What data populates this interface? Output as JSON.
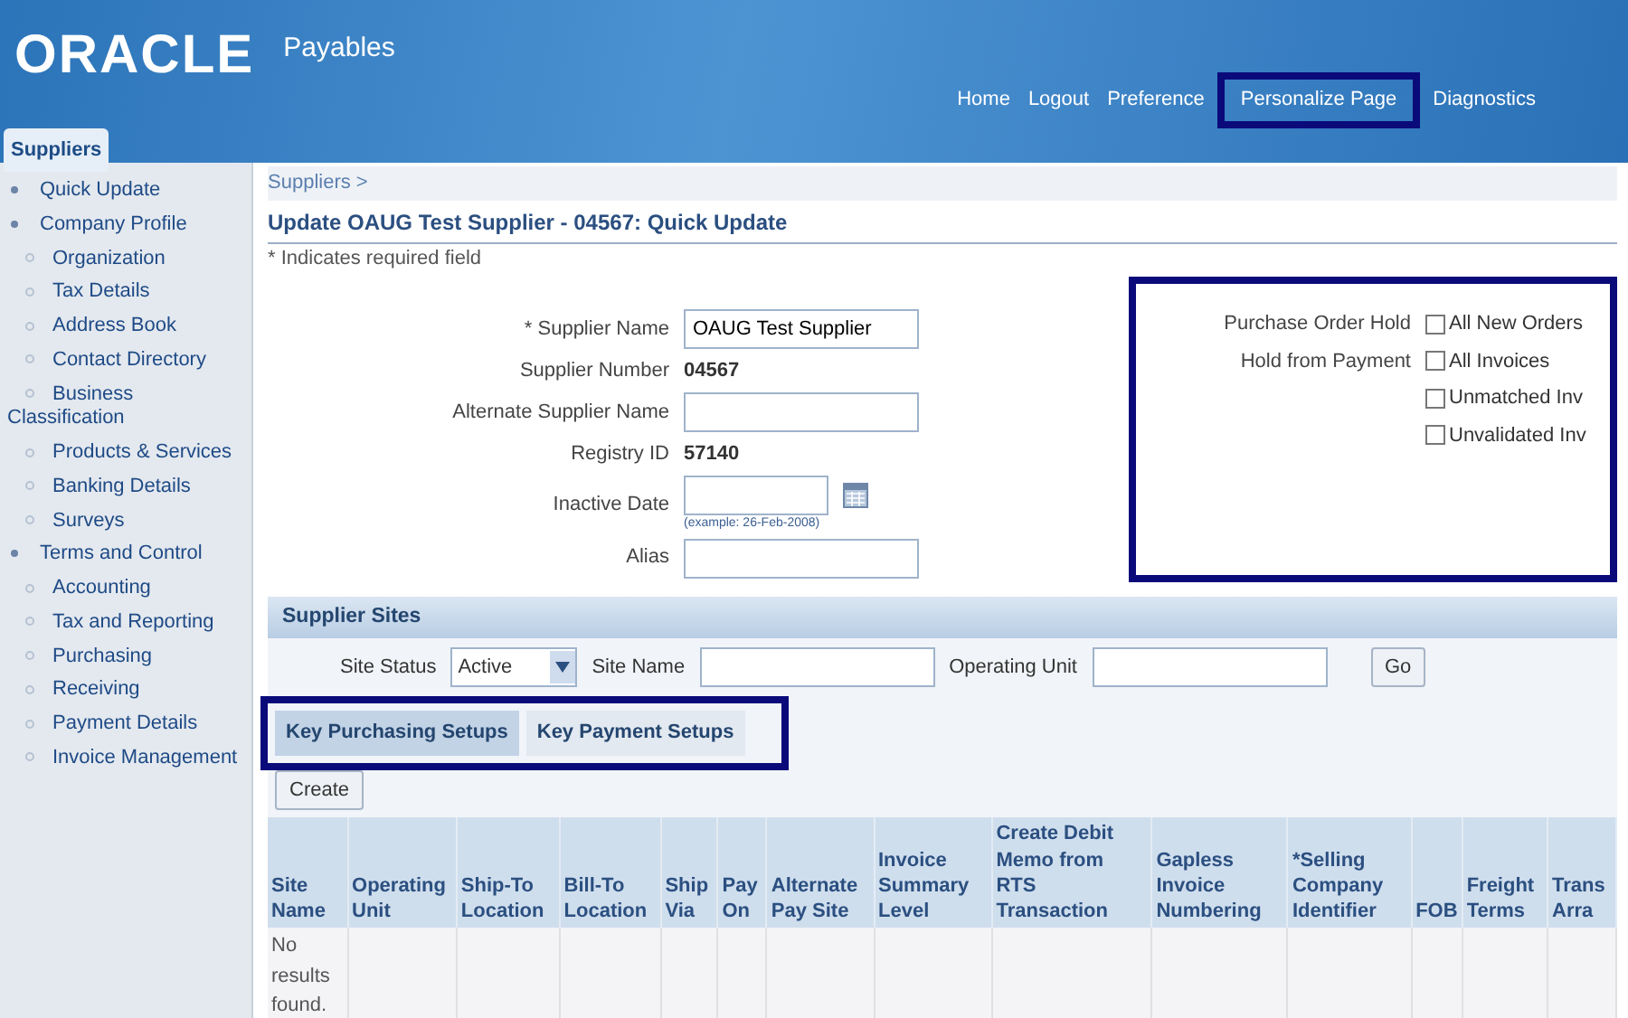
{
  "header": {
    "logo": "ORACLE",
    "app": "Payables",
    "links": [
      {
        "label": "Home",
        "highlighted": false
      },
      {
        "label": "Logout",
        "highlighted": false
      },
      {
        "label": "Preference",
        "highlighted": false
      },
      {
        "label": "Personalize Page",
        "highlighted": true
      },
      {
        "label": "Diagnostics",
        "highlighted": false
      }
    ],
    "tabs": [
      {
        "label": "Suppliers",
        "selected": true
      }
    ]
  },
  "sidebar": {
    "items": [
      {
        "label": "Quick Update"
      },
      {
        "label": "Company Profile",
        "children": [
          {
            "label": "Organization"
          },
          {
            "label": "Tax Details"
          },
          {
            "label": "Address Book"
          },
          {
            "label": "Contact Directory"
          },
          {
            "label": "Business Classification"
          },
          {
            "label": "Products & Services"
          },
          {
            "label": "Banking Details"
          },
          {
            "label": "Surveys"
          }
        ]
      },
      {
        "label": "Terms and Control",
        "children": [
          {
            "label": "Accounting"
          },
          {
            "label": "Tax and Reporting"
          },
          {
            "label": "Purchasing"
          },
          {
            "label": "Receiving"
          },
          {
            "label": "Payment Details"
          },
          {
            "label": "Invoice Management"
          }
        ]
      }
    ]
  },
  "breadcrumb": {
    "label": "Suppliers",
    "separator": ">"
  },
  "title": "Update OAUG Test Supplier - 04567: Quick Update",
  "required_note": "* Indicates required field",
  "fields": [
    {
      "kind": "input",
      "label": "* Supplier Name",
      "value": "OAUG Test Supplier"
    },
    {
      "kind": "text",
      "label": "Supplier Number",
      "value": "04567"
    },
    {
      "kind": "input",
      "label": "Alternate Supplier Name"
    },
    {
      "kind": "text",
      "label": "Registry ID",
      "value": "57140"
    },
    {
      "kind": "date",
      "label": "Inactive Date",
      "hint": "(example: 26-Feb-2008)"
    },
    {
      "kind": "input",
      "label": "Alias"
    }
  ],
  "holds": {
    "highlighted": true,
    "groups": [
      {
        "label": "Purchase Order Hold",
        "options": [
          {
            "label": "All New Orders",
            "checked": false
          }
        ]
      },
      {
        "label": "Hold from Payment",
        "options": [
          {
            "label": "All Invoices",
            "checked": false
          },
          {
            "label": "Unmatched Inv",
            "checked": false
          },
          {
            "label": "Unvalidated Inv",
            "checked": false
          }
        ]
      }
    ]
  },
  "sites": {
    "title": "Supplier Sites",
    "filters": [
      {
        "kind": "select",
        "label": "Site Status",
        "value": "Active"
      },
      {
        "kind": "input",
        "label": "Site Name"
      },
      {
        "kind": "input",
        "label": "Operating Unit"
      }
    ],
    "go": "Go",
    "subtabs": {
      "highlighted": true,
      "tabs": [
        {
          "label": "Key Purchasing Setups",
          "selected": true
        },
        {
          "label": "Key Payment Setups",
          "selected": false
        }
      ]
    },
    "create": "Create",
    "table": {
      "columns": [
        "Site Name",
        "Operating Unit",
        "Ship-To Location",
        "Bill-To Location",
        "Ship Via",
        "Pay On",
        "Alternate Pay Site",
        "Invoice Summary Level",
        "Create Debit Memo from RTS Transaction",
        "Gapless Invoice Numbering",
        "*Selling Company Identifier",
        "FOB",
        "Freight Terms",
        "Trans Arra"
      ],
      "empty": "No results found."
    }
  }
}
